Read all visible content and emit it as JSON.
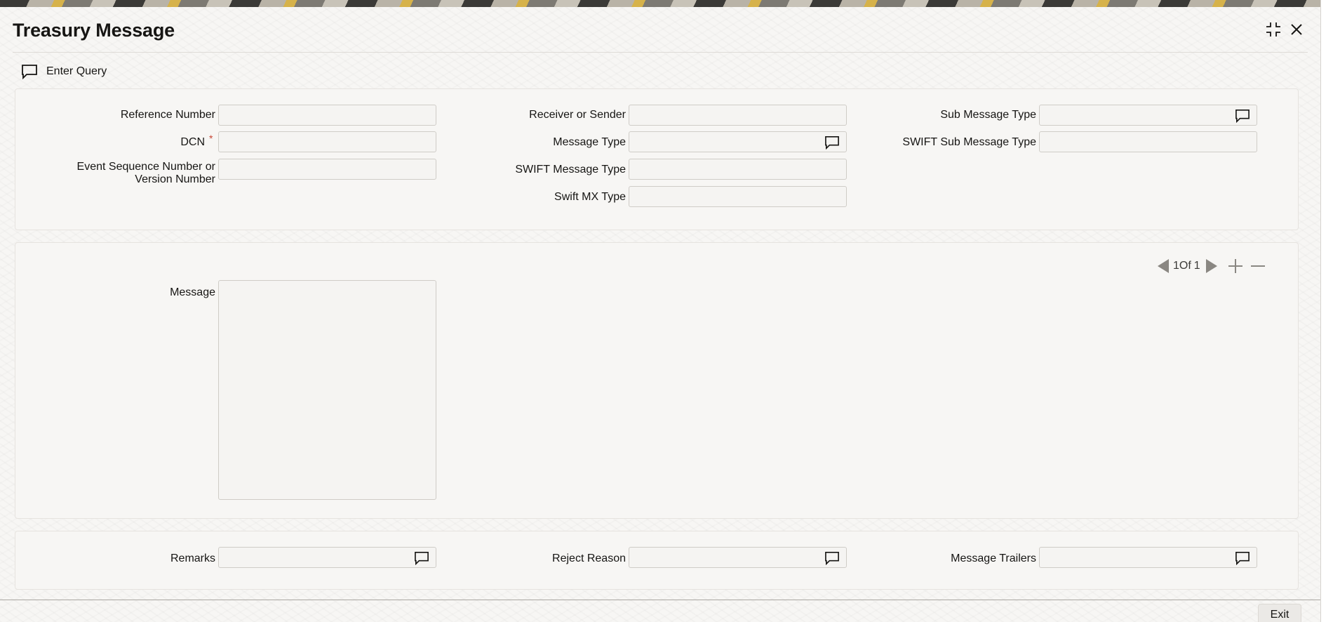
{
  "window": {
    "title": "Treasury Message"
  },
  "toolbar": {
    "enter_query": "Enter Query"
  },
  "header_panel": {
    "reference_number_label": "Reference Number",
    "reference_number_value": "",
    "dcn_label": "DCN",
    "dcn_required_mark": "*",
    "dcn_value": "",
    "event_sequence_label": "Event Sequence Number or Version Number",
    "event_sequence_value": "",
    "receiver_sender_label": "Receiver or Sender",
    "receiver_sender_value": "",
    "message_type_label": "Message Type",
    "message_type_value": "",
    "swift_message_type_label": "SWIFT Message Type",
    "swift_message_type_value": "",
    "swift_mx_type_label": "Swift MX Type",
    "swift_mx_type_value": "",
    "sub_message_type_label": "Sub Message Type",
    "sub_message_type_value": "",
    "swift_sub_message_type_label": "SWIFT Sub Message Type",
    "swift_sub_message_type_value": ""
  },
  "message_panel": {
    "message_label": "Message",
    "message_value": "",
    "pager": {
      "current": "1",
      "of_label": "Of",
      "total": "1"
    }
  },
  "footer_panel": {
    "remarks_label": "Remarks",
    "remarks_value": "",
    "reject_reason_label": "Reject Reason",
    "reject_reason_value": "",
    "message_trailers_label": "Message Trailers",
    "message_trailers_value": ""
  },
  "footer": {
    "exit_label": "Exit"
  },
  "icons": {
    "maximize": "maximize-icon",
    "close": "close-icon",
    "query": "speech-bubble-icon",
    "lov": "speech-bubble-icon",
    "prev": "triangle-left-icon",
    "next": "triangle-right-icon",
    "add": "plus-icon",
    "remove": "minus-icon"
  },
  "colors": {
    "required": "#c74634",
    "text": "#161513",
    "background": "#f7f6f4"
  }
}
